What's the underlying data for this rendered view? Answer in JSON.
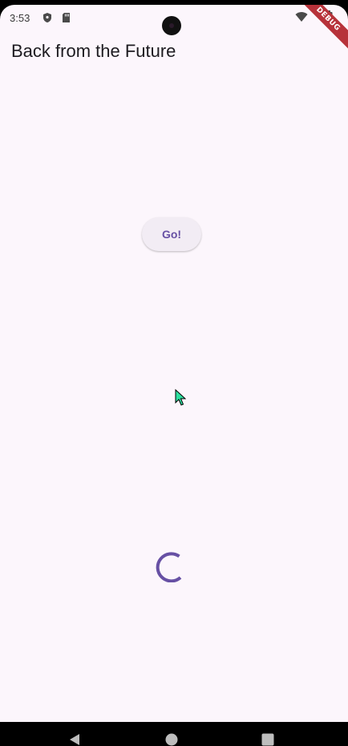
{
  "status_bar": {
    "time": "3:53",
    "icons": [
      "shield-icon",
      "sd-card-icon",
      "wifi-icon",
      "battery-icon"
    ]
  },
  "debug_banner": {
    "label": "DEBUG",
    "color": "#b7323a"
  },
  "app_bar": {
    "title": "Back from the Future"
  },
  "main": {
    "button_label": "Go!",
    "loading": true
  },
  "navigation": {
    "buttons": [
      "back-icon",
      "home-icon",
      "recents-icon"
    ]
  },
  "colors": {
    "background": "#fcf6fc",
    "accent": "#6750a4",
    "button_bg": "#f2ecf4"
  }
}
